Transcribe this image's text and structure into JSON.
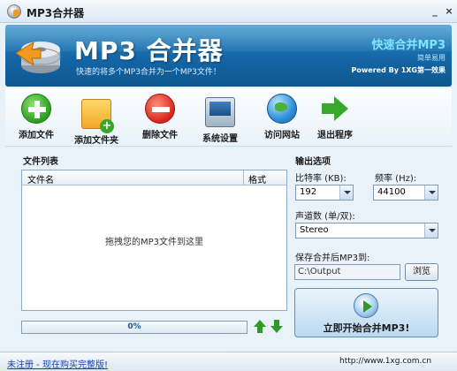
{
  "window": {
    "title": "MP3合并器",
    "minimize": "_",
    "close": "×"
  },
  "banner": {
    "title": "MP3 合并器",
    "subtitle": "快速的将多个MP3合并为一个MP3文件！",
    "slogan": "快速合并MP3",
    "simple": "简单易用",
    "powered": "Powered By 1XG第一效果"
  },
  "toolbar": {
    "items": [
      {
        "label": "添加文件",
        "icon": "add-file-icon"
      },
      {
        "label": "添加文件夹",
        "icon": "add-folder-icon"
      },
      {
        "label": "删除文件",
        "icon": "delete-icon"
      },
      {
        "label": "系统设置",
        "icon": "settings-monitor-icon"
      },
      {
        "label": "访问网站",
        "icon": "globe-icon"
      },
      {
        "label": "退出程序",
        "icon": "exit-arrow-icon"
      }
    ]
  },
  "filelist": {
    "title": "文件列表",
    "columns": [
      "文件名",
      "格式"
    ],
    "empty_hint": "拖拽您的MP3文件到这里"
  },
  "progress": {
    "label": "0%",
    "value": 0
  },
  "output": {
    "title": "输出选项",
    "bitrate_label": "比特率 (KB):",
    "bitrate_value": "192",
    "frequency_label": "频率 (Hz):",
    "frequency_value": "44100",
    "channels_label": "声道数 (单/双):",
    "channels_value": "Stereo",
    "save_label": "保存合并后MP3到:",
    "save_path": "C:\\Output",
    "browse_label": "浏览",
    "start_label": "立即开始合并MP3!"
  },
  "status": {
    "register_link": "未注册 - 现在购买完整版!",
    "website": "http://www.1xg.com.cn"
  }
}
